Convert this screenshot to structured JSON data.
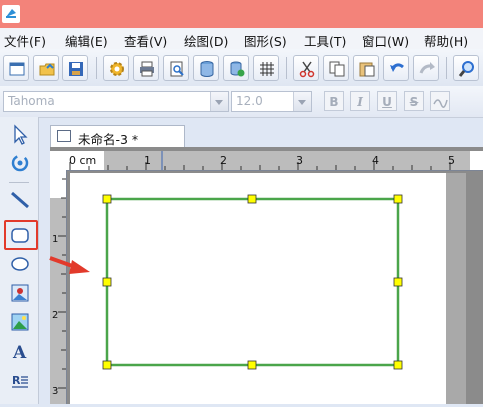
{
  "menu": [
    {
      "label": "文件(F)"
    },
    {
      "label": "编辑(E)"
    },
    {
      "label": "查看(V)"
    },
    {
      "label": "绘图(D)"
    },
    {
      "label": "图形(S)"
    },
    {
      "label": "工具(T)"
    },
    {
      "label": "窗口(W)"
    },
    {
      "label": "帮助(H)"
    }
  ],
  "format": {
    "font_name": "Tahoma",
    "font_size": "12.0",
    "bold": "B",
    "italic": "I",
    "underline": "U",
    "strike": "S"
  },
  "document": {
    "tab_title": "未命名-3 *",
    "ruler_unit": "0 cm",
    "h_ticks": [
      "1",
      "2",
      "3",
      "4",
      "5"
    ],
    "v_ticks": [
      "1",
      "2",
      "3"
    ]
  },
  "icons": [
    "app-icon",
    "new-icon",
    "open-icon",
    "save-icon",
    "settings-icon",
    "print-icon",
    "print-preview-icon",
    "database-icon",
    "database-settings-icon",
    "grid-icon",
    "cut-icon",
    "copy-icon",
    "paste-icon",
    "undo-icon",
    "redo-icon",
    "zoom-icon",
    "select-icon",
    "rotate-icon",
    "line-icon",
    "rounded-rect-icon",
    "ellipse-icon",
    "image-icon",
    "picture-icon",
    "text-icon",
    "rich-text-icon"
  ],
  "colors": {
    "titlebar": "#f3837a",
    "selection_rect": "#4aa54a",
    "handle": "#ffff00",
    "highlight": "#e23a2b"
  }
}
